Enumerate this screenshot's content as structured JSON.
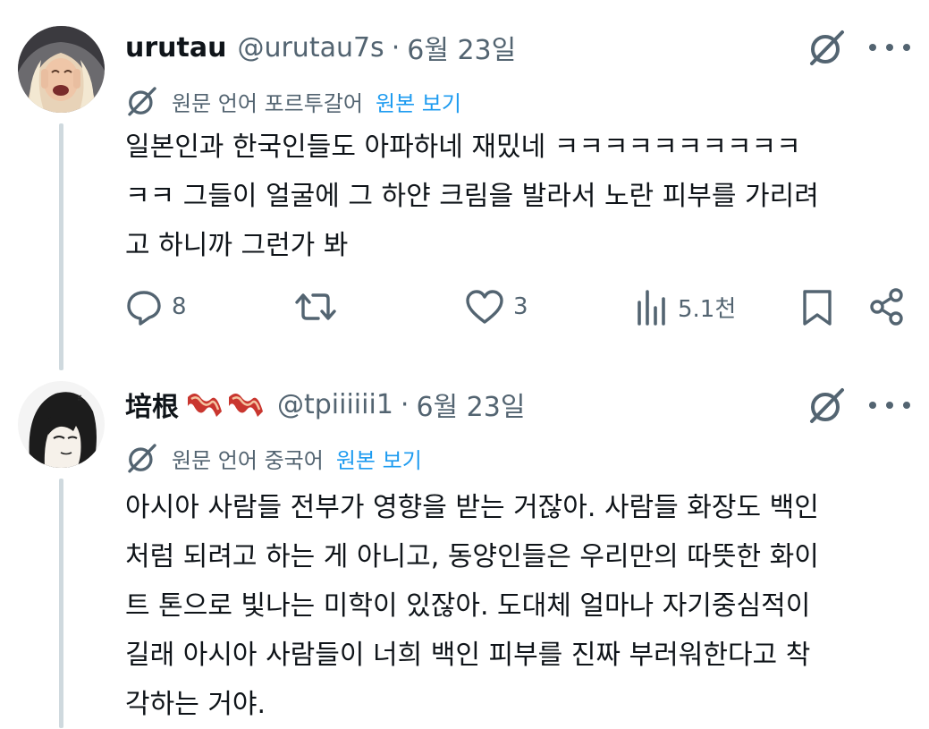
{
  "tweets": [
    {
      "display_name": "urutau",
      "handle": "@urutau7s",
      "separator": "·",
      "date": "6월 23일",
      "translation": {
        "language_note": "원문 언어 포르투갈어",
        "show_original": "원본 보기"
      },
      "text_lines": [
        "일본인과 한국인들도 아파하네 재밌네 ㅋㅋㅋㅋㅋㅋㅋㅋㅋㅋ",
        "ㅋㅋ 그들이 얼굴에 그 하얀 크림을 발라서 노란 피부를 가리려",
        "고 하니까 그런가 봐"
      ],
      "actions": {
        "replies": "8",
        "reposts": "",
        "likes": "3",
        "views": "5.1천"
      }
    },
    {
      "display_name": "培根",
      "name_emoji": "🥓🥓",
      "handle": "@tpiiiiii1",
      "separator": "·",
      "date": "6월 23일",
      "translation": {
        "language_note": "원문 언어 중국어",
        "show_original": "원본 보기"
      },
      "text_lines": [
        "아시아 사람들 전부가 영향을 받는 거잖아. 사람들 화장도 백인",
        "처럼 되려고 하는 게 아니고, 동양인들은 우리만의 따뜻한 화이",
        "트 톤으로 빛나는 미학이 있잖아. 도대체 얼마나 자기중심적이",
        "길래 아시아 사람들이 너희 백인 피부를 진짜 부러워한다고 착",
        "각하는 거야."
      ]
    }
  ],
  "icons": {
    "grok": "grok-icon",
    "more": "more-icon",
    "translate": "translate-icon",
    "reply": "reply-icon",
    "repost": "repost-icon",
    "like": "like-icon",
    "views": "views-icon",
    "bookmark": "bookmark-icon",
    "share": "share-icon"
  },
  "colors": {
    "link": "#1d9bf0",
    "secondary": "#536471",
    "text": "#0f1419",
    "thread": "#cfd9de"
  }
}
